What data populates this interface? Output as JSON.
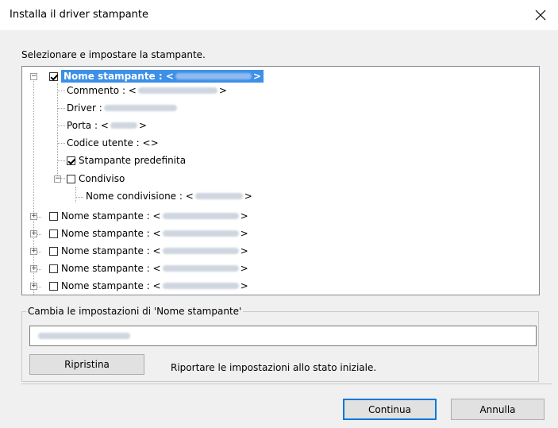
{
  "window": {
    "title": "Installa il driver stampante"
  },
  "instruction": "Selezionare e impostare la stampante.",
  "tree": {
    "selected_prefix": "Nome stampante : <",
    "selected_suffix": ">",
    "commento_prefix": "Commento : <",
    "commento_suffix": ">",
    "driver_label": "Driver :",
    "porta_prefix": "Porta : <",
    "porta_suffix": ">",
    "codice_utente": "Codice utente : <>",
    "stampante_predefinita": "Stampante predefinita",
    "condiviso": "Condiviso",
    "nome_condivisione_prefix": "Nome condivisione : <",
    "nome_condivisione_suffix": ">",
    "printer_prefix": "Nome stampante : <",
    "printer_suffix": ">"
  },
  "settings": {
    "group_label": "Cambia le impostazioni di 'Nome stampante'",
    "reset_button": "Ripristina",
    "reset_description": "Riportare le impostazioni allo stato iniziale."
  },
  "footer": {
    "continue_button": "Continua",
    "cancel_button": "Annulla"
  },
  "colors": {
    "selection": "#3d8fe8",
    "dialog_bg": "#f0f0f0",
    "focus_border": "#0078d7"
  },
  "icons": {
    "close": "close-icon",
    "collapse": "minus-box-icon",
    "expand": "plus-box-icon"
  }
}
